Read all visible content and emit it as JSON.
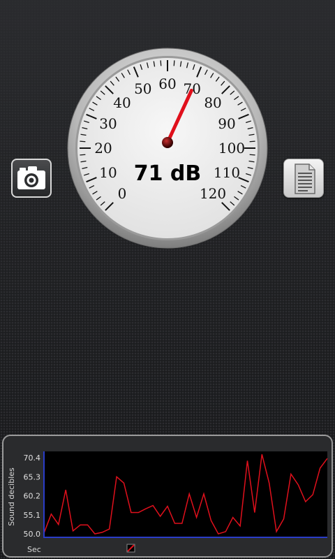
{
  "meter": {
    "reading_value": 71,
    "reading_text": "71 dB",
    "scale_min": 0,
    "scale_max": 120,
    "scale_labels": [
      "0",
      "10",
      "20",
      "30",
      "40",
      "50",
      "60",
      "70",
      "80",
      "90",
      "100",
      "110",
      "120"
    ],
    "needle_color": "#e0101c",
    "face_color": "#eeeeee",
    "bezel_color": "#bdbdbd"
  },
  "buttons": {
    "camera_icon": "camera-icon",
    "notes_icon": "document-icon"
  },
  "chart_data": {
    "type": "line",
    "ylabel": "Sound decibles",
    "xlabel": "Sec",
    "ylim": [
      50.0,
      70.4
    ],
    "yticks": [
      "70.4",
      "65.3",
      "60.2",
      "55.1",
      "50.0"
    ],
    "grid": false,
    "line_color": "#e0101c",
    "plot_background": "#000000",
    "axis_color": "#2a3cc8",
    "series": [
      {
        "values": [
          50.2,
          55.3,
          52.5,
          61.8,
          50.8,
          52.4,
          52.4,
          50.0,
          50.4,
          51.3,
          65.3,
          63.6,
          55.7,
          55.7,
          56.7,
          57.6,
          54.7,
          57.4,
          52.8,
          52.8,
          60.7,
          54.4,
          60.7,
          53.6,
          50.0,
          50.6,
          54.4,
          52.1,
          69.6,
          55.7,
          71.3,
          63.6,
          50.6,
          54.0,
          66.0,
          63.1,
          58.6,
          60.5,
          67.6,
          70.2
        ]
      }
    ]
  }
}
